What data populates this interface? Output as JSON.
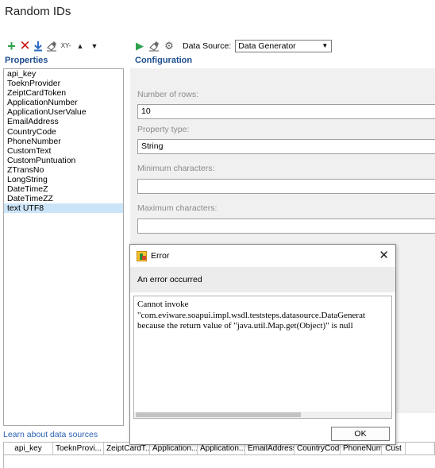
{
  "window_title": "Random IDs",
  "left_toolbar": {
    "icons": [
      "plus-icon",
      "delete-icon",
      "download-icon",
      "eraser-icon",
      "xy-icon",
      "move-up-icon",
      "move-down-icon"
    ],
    "xy_label": "XY-"
  },
  "properties": {
    "title": "Properties",
    "items": [
      "api_key",
      "ToeknProvider",
      "ZeiptCardToken",
      "ApplicationNumber",
      "ApplicationUserValue",
      "EmailAddress",
      "CountryCode",
      "PhoneNumber",
      "CustomText",
      "CustomPuntuation",
      "ZTransNo",
      "LongString",
      "DateTimeZ",
      "DateTimeZZ",
      "text UTF8"
    ],
    "selected_index": 14
  },
  "right_toolbar": {
    "icons": [
      "run-icon",
      "eraser-icon",
      "gear-icon"
    ],
    "data_source_label": "Data Source:",
    "data_source_value": "Data Generator"
  },
  "configuration": {
    "title": "Configuration",
    "number_of_rows_label": "Number of rows:",
    "number_of_rows_value": "10",
    "property_type_label": "Property type:",
    "property_type_value": "String",
    "min_chars_label": "Minimum characters:",
    "min_chars_value": "",
    "max_chars_label": "Maximum characters:",
    "max_chars_value": ""
  },
  "learn_link": "Learn about data sources",
  "grid": {
    "columns": [
      "api_key",
      "ToeknProvi...",
      "ZeiptCardT...",
      "Application...",
      "Application...",
      "EmailAddress",
      "CountryCode",
      "PhoneNum...",
      "Cust"
    ]
  },
  "dialog": {
    "title": "Error",
    "message": "An error occurred",
    "text_lines": [
      "Cannot invoke",
      "\"com.eviware.soapui.impl.wsdl.teststeps.datasource.DataGenerat",
      " because the return value of \"java.util.Map.get(Object)\" is null"
    ],
    "ok_label": "OK",
    "close_glyph": "✕"
  },
  "colors": {
    "accent_blue": "#1e4f8f",
    "link": "#2c62b5",
    "selection": "#cce4f7",
    "add_green": "#2aa14a",
    "delete_red": "#d01818"
  }
}
